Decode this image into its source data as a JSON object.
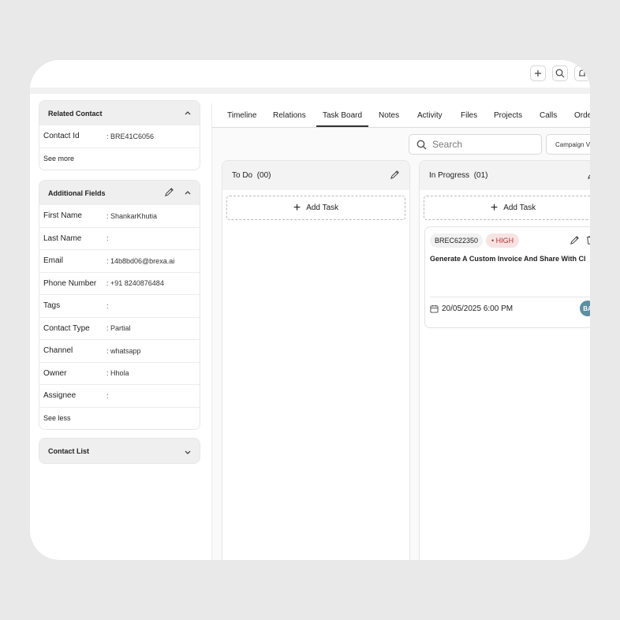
{
  "related_contact": {
    "title": "Related Contact",
    "rows": [
      {
        "key": "Contact Id",
        "value": ": BRE41C6056"
      }
    ],
    "see_more": "See more"
  },
  "additional_fields": {
    "title": "Additional Fields",
    "rows": [
      {
        "key": "First Name",
        "value": ": ShankarKhutia"
      },
      {
        "key": "Last Name",
        "value": ":"
      },
      {
        "key": "Email",
        "value": ": 14b8bd06@brexa.ai"
      },
      {
        "key": "Phone Number",
        "value": ": +91 8240876484"
      },
      {
        "key": "Tags",
        "value": ":"
      },
      {
        "key": "Contact Type",
        "value": ": Partial"
      },
      {
        "key": "Channel",
        "value": ": whatsapp"
      },
      {
        "key": "Owner",
        "value": ": Hhola"
      },
      {
        "key": "Assignee",
        "value": ":"
      }
    ],
    "see_less": "See less"
  },
  "contact_list": {
    "title": "Contact List"
  },
  "tabs": [
    "Timeline",
    "Relations",
    "Task Board",
    "Notes",
    "Activity",
    "Files",
    "Projects",
    "Calls",
    "Orde"
  ],
  "active_tab": "Task Board",
  "search": {
    "placeholder": "Search"
  },
  "campaign_filter": "Campaign V",
  "columns": [
    {
      "name": "To Do",
      "count": "(00)",
      "add_label": "Add Task"
    },
    {
      "name": "In Progress",
      "count": "(01)",
      "add_label": "Add Task"
    }
  ],
  "task": {
    "id": "BREC622350",
    "priority": "• HIGH",
    "title": "Generate A Custom Invoice And Share With Cl",
    "due": "20/05/2025 6:00 PM",
    "assignee_initials": "BA"
  },
  "colors": {
    "priority_bg": "#f8e3e3",
    "priority_text": "#b33434",
    "avatar": "#5d8ea1"
  }
}
